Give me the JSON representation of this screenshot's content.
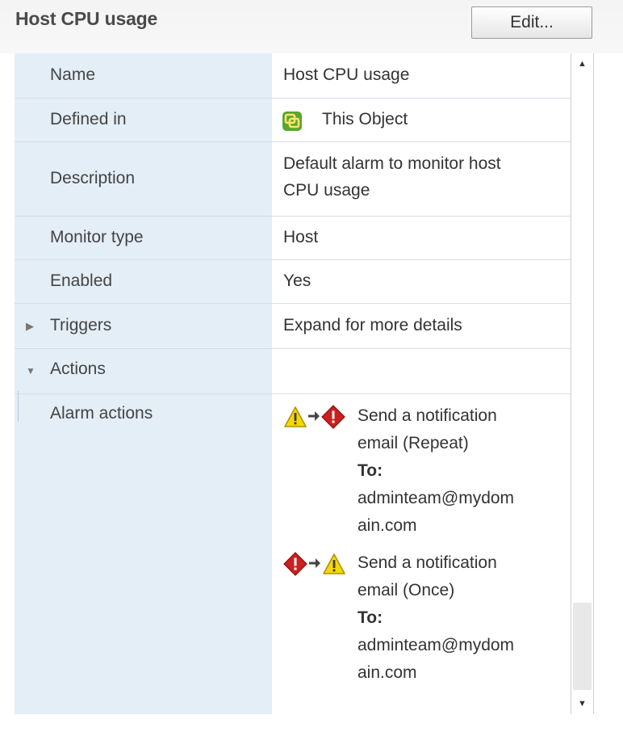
{
  "header": {
    "title": "Host CPU usage",
    "edit_label": "Edit..."
  },
  "rows": {
    "name": {
      "label": "Name",
      "value": "Host CPU usage"
    },
    "defined_in": {
      "label": "Defined in",
      "value": "This Object",
      "icon": "vcenter-object-icon"
    },
    "description": {
      "label": "Description",
      "value_line1": "Default alarm to monitor host",
      "value_line2": "CPU usage"
    },
    "monitor_type": {
      "label": "Monitor type",
      "value": "Host"
    },
    "enabled": {
      "label": "Enabled",
      "value": "Yes"
    },
    "triggers": {
      "label": "Triggers",
      "value": "Expand for more details",
      "expanded": false
    },
    "actions": {
      "label": "Actions",
      "expanded": true
    },
    "alarm_actions": {
      "label": "Alarm actions",
      "items": [
        {
          "from_icon": "warning-icon",
          "to_icon": "alert-icon",
          "line1": "Send a notification",
          "line2": "email (Repeat)",
          "to_label": "To:",
          "email_line1": "adminteam@mydom",
          "email_line2": "ain.com"
        },
        {
          "from_icon": "alert-icon",
          "to_icon": "warning-icon",
          "line1": "Send a notification",
          "line2": "email (Once)",
          "to_label": "To:",
          "email_line1": "adminteam@mydom",
          "email_line2": "ain.com"
        }
      ]
    }
  },
  "colors": {
    "label_bg": "#e4eef6",
    "warning": "#f5d800",
    "alert": "#cc1f1f"
  }
}
